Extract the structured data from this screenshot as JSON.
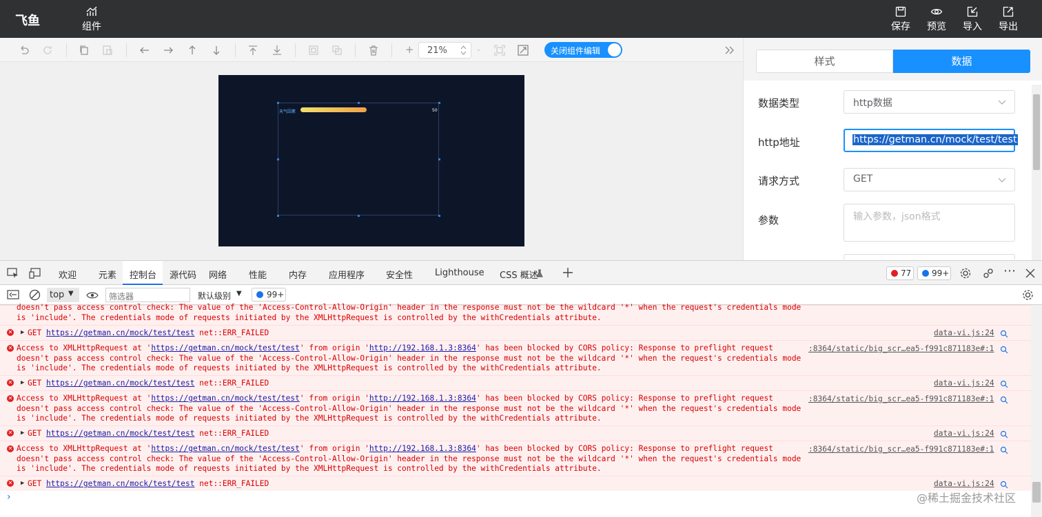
{
  "app": {
    "logo": "飞鱼",
    "components_label": "组件"
  },
  "top_actions": [
    {
      "label": "保存",
      "icon": "save-icon"
    },
    {
      "label": "预览",
      "icon": "eye-icon"
    },
    {
      "label": "导入",
      "icon": "import-icon"
    },
    {
      "label": "导出",
      "icon": "export-icon"
    }
  ],
  "toolbar": {
    "zoom": "21%",
    "toggle_label": "关闭组件编辑",
    "plus": "+",
    "minus": "-"
  },
  "canvas": {
    "component_label": "天气因素",
    "component_value": "50",
    "bar_fraction": 0.41
  },
  "panel": {
    "tabs": [
      "样式",
      "数据"
    ],
    "fields": [
      {
        "label": "数据类型",
        "value": "http数据"
      },
      {
        "label": "http地址",
        "value": "https://getman.cn/mock/test/test"
      },
      {
        "label": "请求方式",
        "value": "GET"
      },
      {
        "label": "参数",
        "placeholder": "输入参数，json格式"
      }
    ]
  },
  "devtools": {
    "tabs": [
      "欢迎",
      "元素",
      "控制台",
      "源代码",
      "网络",
      "性能",
      "内存",
      "应用程序",
      "安全性",
      "Lighthouse",
      "CSS 概述"
    ],
    "error_count": "77",
    "message_count": "99+",
    "context": "top",
    "filter_placeholder": "筛选器",
    "level": "默认级别",
    "issues": "99+"
  },
  "console": {
    "top_partial_line1": "doesn't pass access control check: The value of the 'Access-Control-Allow-Origin' header in the response must not be the wildcard '*' when the request's credentials mode",
    "top_partial_line2": "is 'include'. The credentials mode of requests initiated by the XMLHttpRequest is controlled by the withCredentials attribute.",
    "get_prefix": "GET ",
    "get_url": "https://getman.cn/mock/test/test",
    "get_suffix": " net::ERR_FAILED",
    "cors_a": "Access to XMLHttpRequest at '",
    "cors_url": "https://getman.cn/mock/test/test",
    "cors_b": "' from origin '",
    "cors_origin": "http://192.168.1.3:8364",
    "cors_c": "' has been blocked by CORS policy: Response to preflight request",
    "cors_line2": "doesn't pass access control check: The value of the 'Access-Control-Allow-Origin' header in the response must not be the wildcard '*' when the request's credentials mode",
    "cors_line3": "is 'include'. The credentials mode of requests initiated by the XMLHttpRequest is controlled by the withCredentials attribute.",
    "src_get": "data-vi.js:24",
    "src_cors": ":8364/static/big_scr…ea5-f991c871183e#:1"
  },
  "watermark": "@稀土掘金技术社区",
  "colors": {
    "topbar": "#303133",
    "accent": "#1890ff",
    "canvas_bg": "#0d1629",
    "error_bg": "#fff0f0",
    "error_text": "#d70000"
  }
}
